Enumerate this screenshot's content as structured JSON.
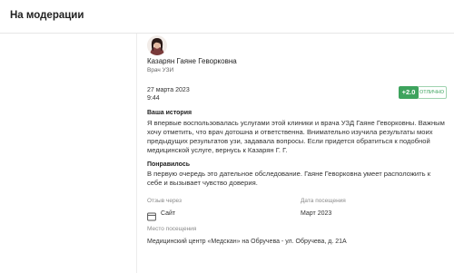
{
  "header": {
    "title": "На модерации"
  },
  "doctor": {
    "name": "Казарян Гаяне Геворковна",
    "role": "Врач УЗИ"
  },
  "review": {
    "date": "27 марта 2023",
    "time": "9:44",
    "score": "+2.0",
    "score_label": "ОТЛИЧНО",
    "story_heading": "Ваша история",
    "story_text": "Я впервые воспользовалась услугами этой клиники и врача УЗД Гаяне Геворковны. Важным хочу отметить, что врач дотошна и ответственна. Внимательно изучила результаты моих предыдущих результатов узи, задавала вопросы. Если придется обратиться к подобной медицинской услуге, вернусь к Казарян Г. Г.",
    "liked_heading": "Понравилось",
    "liked_text": "В первую очередь это дательное обследование. Гаяне Геворковна умеет расположить к себе и вызывает чувство доверия."
  },
  "meta": {
    "source_label": "Отзыв через",
    "source_value": "Сайт",
    "visit_date_label": "Дата посещения",
    "visit_date_value": "Март 2023",
    "place_label": "Место посещения",
    "place_value": "Медицинский центр «Медскан» на Обручева - ул. Обручева, д. 21А"
  },
  "colors": {
    "score_green": "#3da35d",
    "divider": "#e6e6e6"
  },
  "icons": {
    "avatar": "doctor-photo",
    "source": "browser-window-icon"
  }
}
